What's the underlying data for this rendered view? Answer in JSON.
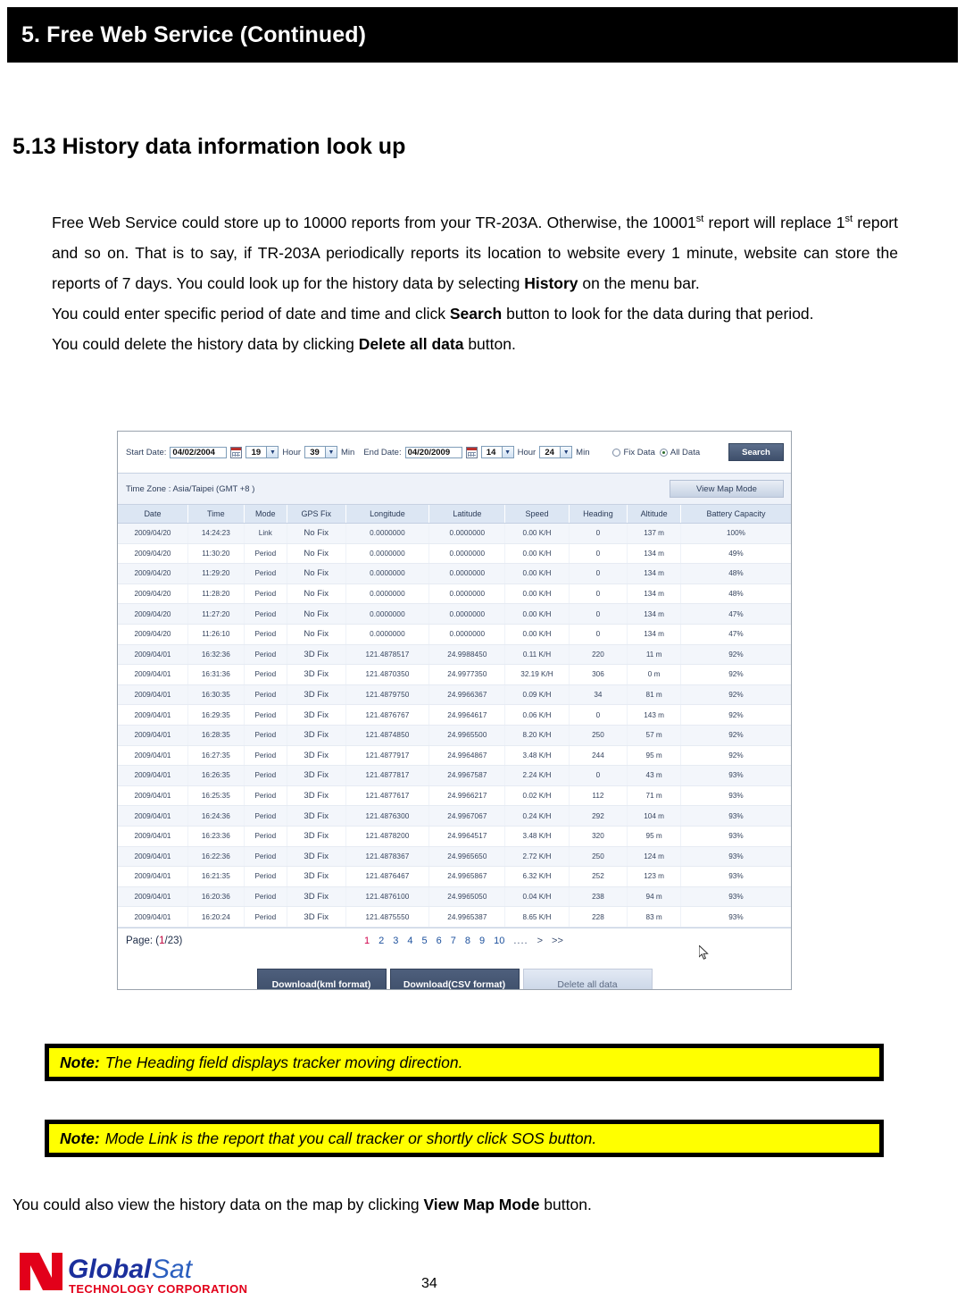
{
  "chapter": {
    "title": "5. Free Web Service (Continued)"
  },
  "section": {
    "heading": "5.13 History data information look up"
  },
  "body": {
    "p1_part1": "Free Web Service could store up to 10000 reports from your TR-203A. Otherwise, the 10001",
    "p1_sup1": "st",
    "p1_part2": " report will replace 1",
    "p1_sup2": "st",
    "p1_part3": " report and so on. That is to say, if TR-203A periodically reports its location to website every 1 minute, website can store the reports of 7 days. You could look up for the history data by selecting ",
    "p1_bold": "History",
    "p1_part4": " on the menu bar.",
    "p2_part1": "You could enter specific period of date and time and click ",
    "p2_bold": "Search",
    "p2_part2": " button to look for the data during that period.",
    "p3_part1": "You could delete the history data by clicking ",
    "p3_bold": "Delete all data",
    "p3_part2": " button."
  },
  "app": {
    "toolbar": {
      "start_date_label": "Start Date:",
      "start_date_value": "04/02/2004",
      "start_hour_value": "19",
      "hour_label_1": "Hour",
      "start_min_value": "39",
      "min_label_1": "Min",
      "end_date_label": "End Date:",
      "end_date_value": "04/20/2009",
      "end_hour_value": "14",
      "hour_label_2": "Hour",
      "end_min_value": "24",
      "min_label_2": "Min",
      "radio_fix_label": "Fix Data",
      "radio_all_label": "All Data",
      "radio_selected": "All Data",
      "search_label": "Search"
    },
    "timezone": {
      "text": "Time Zone : Asia/Taipei (GMT +8 )",
      "map_mode_label": "View Map Mode"
    },
    "table": {
      "columns": [
        "Date",
        "Time",
        "Mode",
        "GPS Fix",
        "Longitude",
        "Latitude",
        "Speed",
        "Heading",
        "Altitude",
        "Battery Capacity"
      ],
      "rows": [
        [
          "2009/04/20",
          "14:24:23",
          "Link",
          "No Fix",
          "0.0000000",
          "0.0000000",
          "0.00 K/H",
          "0",
          "137 m",
          "100%"
        ],
        [
          "2009/04/20",
          "11:30:20",
          "Period",
          "No Fix",
          "0.0000000",
          "0.0000000",
          "0.00 K/H",
          "0",
          "134 m",
          "49%"
        ],
        [
          "2009/04/20",
          "11:29:20",
          "Period",
          "No Fix",
          "0.0000000",
          "0.0000000",
          "0.00 K/H",
          "0",
          "134 m",
          "48%"
        ],
        [
          "2009/04/20",
          "11:28:20",
          "Period",
          "No Fix",
          "0.0000000",
          "0.0000000",
          "0.00 K/H",
          "0",
          "134 m",
          "48%"
        ],
        [
          "2009/04/20",
          "11:27:20",
          "Period",
          "No Fix",
          "0.0000000",
          "0.0000000",
          "0.00 K/H",
          "0",
          "134 m",
          "47%"
        ],
        [
          "2009/04/20",
          "11:26:10",
          "Period",
          "No Fix",
          "0.0000000",
          "0.0000000",
          "0.00 K/H",
          "0",
          "134 m",
          "47%"
        ],
        [
          "2009/04/01",
          "16:32:36",
          "Period",
          "3D Fix",
          "121.4878517",
          "24.9988450",
          "0.11 K/H",
          "220",
          "11 m",
          "92%"
        ],
        [
          "2009/04/01",
          "16:31:36",
          "Period",
          "3D Fix",
          "121.4870350",
          "24.9977350",
          "32.19 K/H",
          "306",
          "0 m",
          "92%"
        ],
        [
          "2009/04/01",
          "16:30:35",
          "Period",
          "3D Fix",
          "121.4879750",
          "24.9966367",
          "0.09 K/H",
          "34",
          "81 m",
          "92%"
        ],
        [
          "2009/04/01",
          "16:29:35",
          "Period",
          "3D Fix",
          "121.4876767",
          "24.9964617",
          "0.06 K/H",
          "0",
          "143 m",
          "92%"
        ],
        [
          "2009/04/01",
          "16:28:35",
          "Period",
          "3D Fix",
          "121.4874850",
          "24.9965500",
          "8.20 K/H",
          "250",
          "57 m",
          "92%"
        ],
        [
          "2009/04/01",
          "16:27:35",
          "Period",
          "3D Fix",
          "121.4877917",
          "24.9964867",
          "3.48 K/H",
          "244",
          "95 m",
          "92%"
        ],
        [
          "2009/04/01",
          "16:26:35",
          "Period",
          "3D Fix",
          "121.4877817",
          "24.9967587",
          "2.24 K/H",
          "0",
          "43 m",
          "93%"
        ],
        [
          "2009/04/01",
          "16:25:35",
          "Period",
          "3D Fix",
          "121.4877617",
          "24.9966217",
          "0.02 K/H",
          "112",
          "71 m",
          "93%"
        ],
        [
          "2009/04/01",
          "16:24:36",
          "Period",
          "3D Fix",
          "121.4876300",
          "24.9967067",
          "0.24 K/H",
          "292",
          "104 m",
          "93%"
        ],
        [
          "2009/04/01",
          "16:23:36",
          "Period",
          "3D Fix",
          "121.4878200",
          "24.9964517",
          "3.48 K/H",
          "320",
          "95 m",
          "93%"
        ],
        [
          "2009/04/01",
          "16:22:36",
          "Period",
          "3D Fix",
          "121.4878367",
          "24.9965650",
          "2.72 K/H",
          "250",
          "124 m",
          "93%"
        ],
        [
          "2009/04/01",
          "16:21:35",
          "Period",
          "3D Fix",
          "121.4876467",
          "24.9965867",
          "6.32 K/H",
          "252",
          "123 m",
          "93%"
        ],
        [
          "2009/04/01",
          "16:20:36",
          "Period",
          "3D Fix",
          "121.4876100",
          "24.9965050",
          "0.04 K/H",
          "238",
          "94 m",
          "93%"
        ],
        [
          "2009/04/01",
          "16:20:24",
          "Period",
          "3D Fix",
          "121.4875550",
          "24.9965387",
          "8.65 K/H",
          "228",
          "83 m",
          "93%"
        ]
      ]
    },
    "pager": {
      "label_prefix": "Page: (",
      "current_page": "1",
      "separator": "/",
      "total_pages": "23",
      "label_suffix": ")",
      "links": [
        "1",
        "2",
        "3",
        "4",
        "5",
        "6",
        "7",
        "8",
        "9",
        "10"
      ],
      "dots": "....",
      "next": ">",
      "last": ">>"
    },
    "footer_buttons": {
      "kml_label": "Download(kml format)",
      "csv_label": "Download(CSV format)",
      "delete_label": "Delete all data"
    }
  },
  "notes": {
    "note1_prefix": "Note:",
    "note1_text": " The Heading field displays tracker moving direction.",
    "note2_prefix": "Note:",
    "note2_text": " Mode Link is the report that you call tracker or shortly click SOS button."
  },
  "closing": {
    "part1": "You could also view the history data on the map by clicking ",
    "bold": "View Map Mode",
    "part2": " button."
  },
  "page_footer": {
    "logo_main": "Global",
    "logo_accent": "Sat",
    "logo_sub": "TECHNOLOGY CORPORATION",
    "page_number": "34"
  },
  "colors": {
    "header_bg": "#000000",
    "note_bg": "#ffff00",
    "logo_blue": "#1b2f9c",
    "logo_red": "#e2001a",
    "table_header": "#dce6f3",
    "accent_btn": "#3e4f6b"
  }
}
